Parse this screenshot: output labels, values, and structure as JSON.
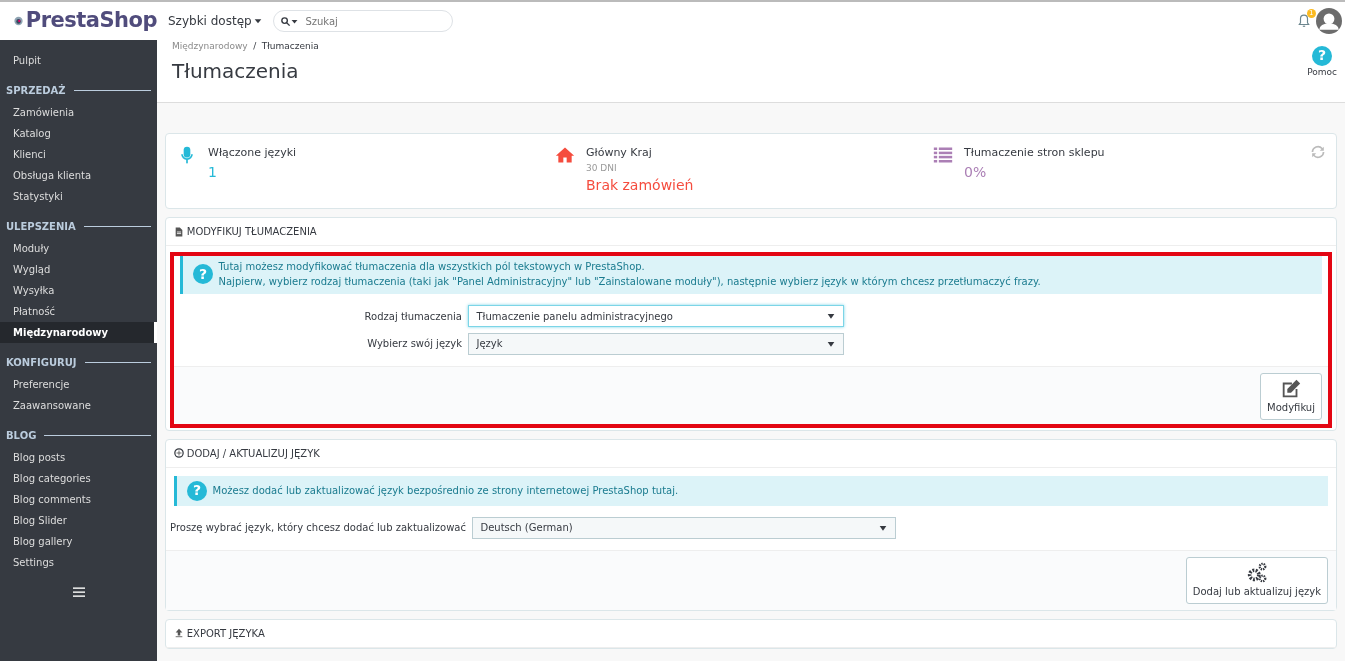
{
  "header": {
    "logo": "PrestaShop",
    "quick_access": "Szybki dostęp",
    "search": {
      "placeholder": "Szukaj"
    },
    "notifications": {
      "count": "1"
    }
  },
  "sidebar": {
    "items": [
      {
        "kind": "link",
        "label": "Pulpit",
        "selected": false
      },
      {
        "kind": "section",
        "label": "SPRZEDAŻ"
      },
      {
        "kind": "link",
        "label": "Zamówienia",
        "selected": false
      },
      {
        "kind": "link",
        "label": "Katalog",
        "selected": false
      },
      {
        "kind": "link",
        "label": "Klienci",
        "selected": false
      },
      {
        "kind": "link",
        "label": "Obsługa klienta",
        "selected": false
      },
      {
        "kind": "link",
        "label": "Statystyki",
        "selected": false
      },
      {
        "kind": "section",
        "label": "ULEPSZENIA"
      },
      {
        "kind": "link",
        "label": "Moduły",
        "selected": false
      },
      {
        "kind": "link",
        "label": "Wygląd",
        "selected": false
      },
      {
        "kind": "link",
        "label": "Wysyłka",
        "selected": false
      },
      {
        "kind": "link",
        "label": "Płatność",
        "selected": false
      },
      {
        "kind": "link",
        "label": "Międzynarodowy",
        "selected": true
      },
      {
        "kind": "section",
        "label": "KONFIGURUJ"
      },
      {
        "kind": "link",
        "label": "Preferencje",
        "selected": false
      },
      {
        "kind": "link",
        "label": "Zaawansowane",
        "selected": false
      },
      {
        "kind": "section",
        "label": "BLOG"
      },
      {
        "kind": "link",
        "label": "Blog posts",
        "selected": false
      },
      {
        "kind": "link",
        "label": "Blog categories",
        "selected": false
      },
      {
        "kind": "link",
        "label": "Blog comments",
        "selected": false
      },
      {
        "kind": "link",
        "label": "Blog Slider",
        "selected": false
      },
      {
        "kind": "link",
        "label": "Blog gallery",
        "selected": false
      },
      {
        "kind": "link",
        "label": "Settings",
        "selected": false
      }
    ]
  },
  "breadcrumb": [
    "Międzynarodowy",
    "Tłumaczenia"
  ],
  "breadcrumb_separator": "/",
  "help_icon": "?",
  "page_title": "Tłumaczenia",
  "help": "Pomoc",
  "kpis": [
    {
      "kind": "mic",
      "label": "Włączone języki",
      "value": "1",
      "color": "#25b9d7"
    },
    {
      "kind": "home",
      "label": "Główny Kraj",
      "sub": "30 DNI",
      "value": "Brak zamówień",
      "color": "#f54c3e"
    },
    {
      "kind": "list",
      "label": "Tłumaczenie stron sklepu",
      "value": "0%",
      "color": "#ab7fb5"
    }
  ],
  "panels": [
    {
      "kind": "file",
      "title": "MODYFIKUJ TŁUMACZENIA",
      "highlighted": true,
      "info_icon": "?",
      "info": [
        "Tutaj możesz modyfikować tłumaczenia dla wszystkich pól tekstowych w PrestaShop.",
        "Najpierw, wybierz rodzaj tłumaczenia (taki jak \"Panel Administracyjny\" lub \"Zainstalowane moduły\"), następnie wybierz język w którym chcesz przetłumaczyć frazy."
      ],
      "fields": [
        {
          "label": "Rodzaj tłumaczenia",
          "value": "Tłumaczenie panelu administracyjnego",
          "focused": true
        },
        {
          "label": "Wybierz swój język",
          "value": "Język",
          "focused": false
        }
      ],
      "button": {
        "kind": "edit",
        "label": "Modyfikuj"
      }
    },
    {
      "kind": "plus",
      "title": "DODAJ / AKTUALIZUJ JĘZYK",
      "highlighted": false,
      "info_icon": "?",
      "info": [
        "Możesz dodać lub zaktualizować język bezpośrednio ze strony internetowej PrestaShop tutaj."
      ],
      "fields": [
        {
          "label": "Proszę wybrać język, który chcesz dodać lub zaktualizować",
          "value": "Deutsch (German)",
          "focused": false
        }
      ],
      "button": {
        "kind": "gears",
        "label": "Dodaj lub aktualizuj język"
      }
    },
    {
      "kind": "upload",
      "title": "EXPORT JĘZYKA",
      "highlighted": false
    }
  ]
}
